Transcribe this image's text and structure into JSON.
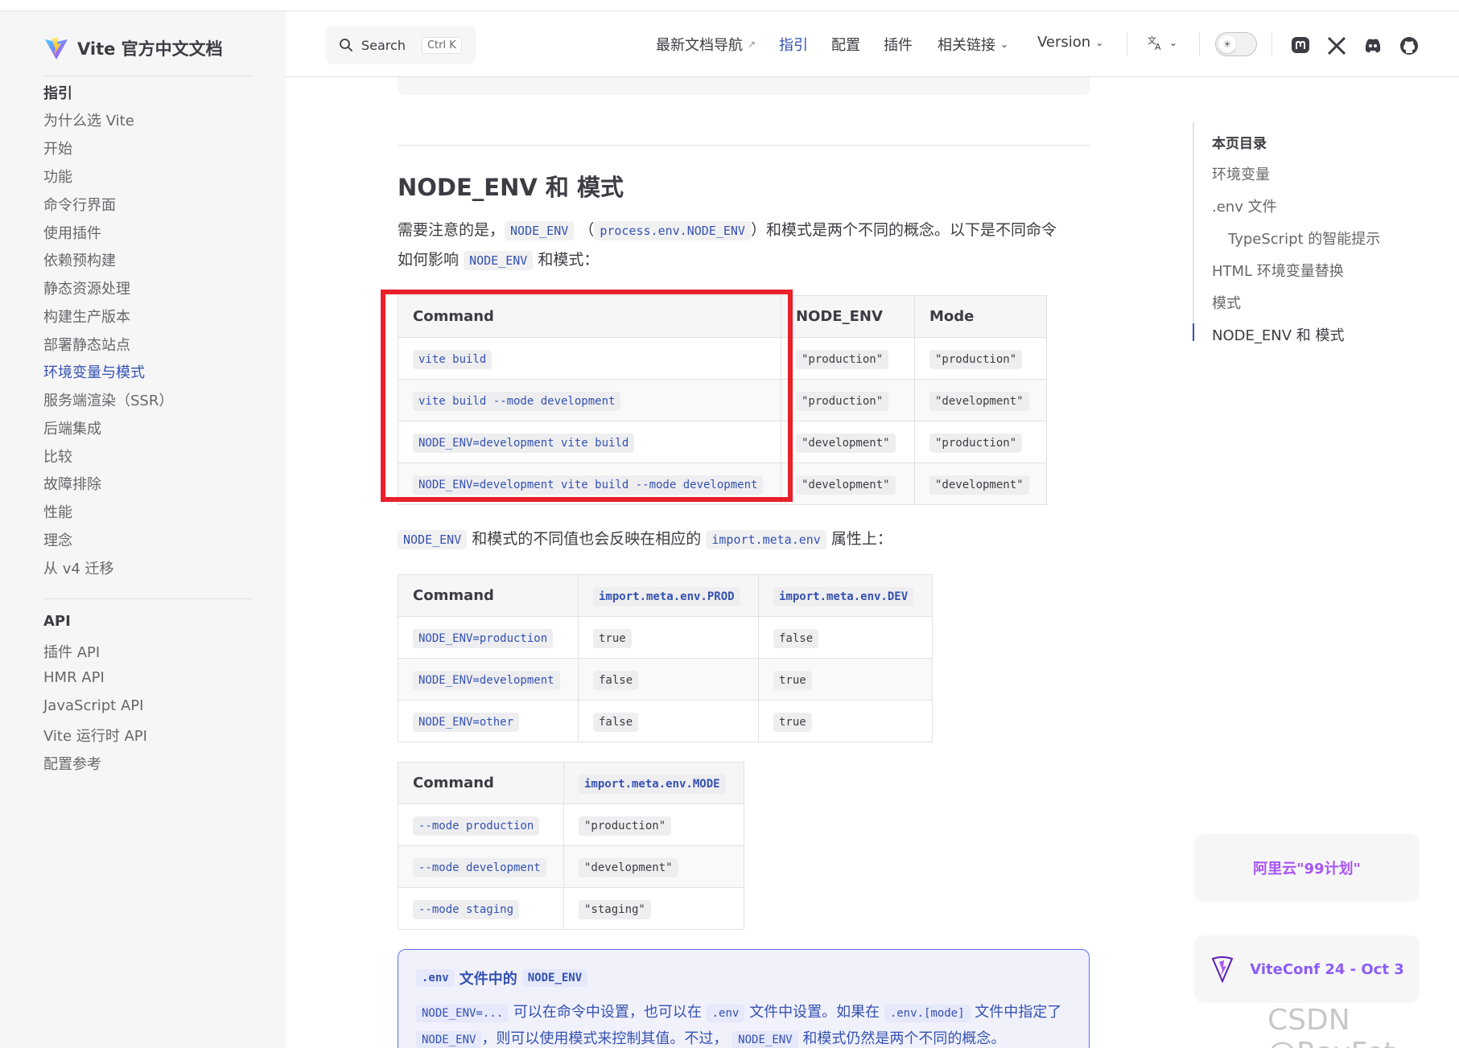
{
  "header": {
    "search_label": "Search",
    "search_shortcut": "Ctrl K",
    "nav": {
      "latest_docs": "最新文档导航",
      "guide": "指引",
      "config": "配置",
      "plugins": "插件",
      "links": "相关链接",
      "version": "Version"
    }
  },
  "sidebar": {
    "brand": "Vite 官方中文文档",
    "guide_title": "指引",
    "guide_items": [
      "为什么选 Vite",
      "开始",
      "功能",
      "命令行界面",
      "使用插件",
      "依赖预构建",
      "静态资源处理",
      "构建生产版本",
      "部署静态站点",
      "环境变量与模式",
      "服务端渲染（SSR）",
      "后端集成",
      "比较",
      "故障排除",
      "性能",
      "理念",
      "从 v4 迁移"
    ],
    "active_item": "环境变量与模式",
    "api_title": "API",
    "api_items": [
      "插件 API",
      "HMR API",
      "JavaScript API",
      "Vite 运行时 API",
      "配置参考"
    ]
  },
  "content": {
    "heading": "NODE_ENV 和 模式",
    "intro": {
      "t1": "需要注意的是，",
      "c1": "NODE_ENV",
      "t2": "（",
      "c2": "process.env.NODE_ENV",
      "t3": "）和模式是两个不同的概念。以下是不同命令",
      "t4": "如何影响",
      "c3": "NODE_ENV",
      "t5": "和模式："
    },
    "table1": {
      "headers": [
        "Command",
        "NODE_ENV",
        "Mode"
      ],
      "rows": [
        [
          "vite build",
          "\"production\"",
          "\"production\""
        ],
        [
          "vite build --mode development",
          "\"production\"",
          "\"development\""
        ],
        [
          "NODE_ENV=development vite build",
          "\"development\"",
          "\"production\""
        ],
        [
          "NODE_ENV=development vite build --mode development",
          "\"development\"",
          "\"development\""
        ]
      ]
    },
    "middle": {
      "c1": "NODE_ENV",
      "t1": "和模式的不同值也会反映在相应的",
      "c2": "import.meta.env",
      "t2": "属性上："
    },
    "table2": {
      "headers": [
        "Command",
        "import.meta.env.PROD",
        "import.meta.env.DEV"
      ],
      "rows": [
        [
          "NODE_ENV=production",
          "true",
          "false"
        ],
        [
          "NODE_ENV=development",
          "false",
          "true"
        ],
        [
          "NODE_ENV=other",
          "false",
          "true"
        ]
      ]
    },
    "table3": {
      "headers": [
        "Command",
        "import.meta.env.MODE"
      ],
      "rows": [
        [
          "--mode production",
          "\"production\""
        ],
        [
          "--mode development",
          "\"development\""
        ],
        [
          "--mode staging",
          "\"staging\""
        ]
      ]
    },
    "tip": {
      "title_c1": ".env",
      "title_t": "文件中的",
      "title_c2": "NODE_ENV",
      "c1": "NODE_ENV=...",
      "t1": "可以在命令中设置，也可以在",
      "c2": ".env",
      "t2": "文件中设置。如果在",
      "c3": ".env.[mode]",
      "t3": "文件中指定了",
      "c4": "NODE_ENV",
      "t4": "，则可以使用模式来控制其值。不过，",
      "c5": "NODE_ENV",
      "t5": "和模式仍然是两个不同的概念。"
    }
  },
  "toc": {
    "title": "本页目录",
    "items": [
      "环境变量",
      ".env 文件",
      "TypeScript 的智能提示",
      "HTML 环境变量替换",
      "模式",
      "NODE_ENV 和 模式"
    ]
  },
  "promos": {
    "aliyun": "阿里云\"99计划\"",
    "viteconf": "ViteConf 24 - Oct 3"
  },
  "watermark": "CSDN @RayFet",
  "colors": {
    "brand": "#3451b2",
    "highlight_box": "#e8202a",
    "sidebar_bg": "#f6f6f7"
  }
}
